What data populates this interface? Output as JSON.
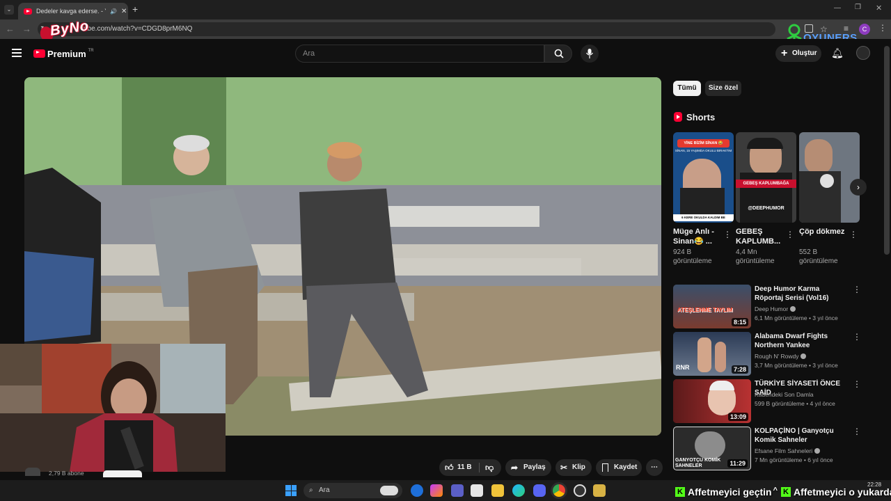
{
  "browser": {
    "tab_title": "Dedeler kavga ederse. - Yo",
    "url": "ube.com/watch?v=CDGD8prM6NQ",
    "new_tab": "+",
    "profile_initial": "C"
  },
  "yt": {
    "premium_label": "Premium",
    "premium_badge": "TR",
    "search_placeholder": "Ara",
    "create_label": "Oluştur"
  },
  "chips": [
    "Tümü",
    "Size özel"
  ],
  "shorts": {
    "title": "Shorts",
    "items": [
      {
        "title": "Müge Anlı - Sinan😂 ...",
        "views": "924 B görüntüleme",
        "overlay_top": "YİNE BİZİM SİNAN 😂",
        "overlay_sub": "SİNAN, 15 YAŞIMDA OKULU BIRAKTIM",
        "overlay_bottom": "6 KERE OKULDA KALDIM BE"
      },
      {
        "title": "GEBEŞ KAPLUMB...",
        "views": "4,4 Mn görüntüleme",
        "overlay_top": "GEBEŞ KAPLUMBAĞA",
        "overlay_bottom": "@DEEPHUMOR"
      },
      {
        "title": "Çöp dökmez",
        "views": "552 B görüntüleme"
      }
    ]
  },
  "related": [
    {
      "title": "Deep Humor Karma Röportaj Serisi (Vol16)",
      "channel": "Deep Humor",
      "meta": "6,1 Mn görüntüleme • 3 yıl önce",
      "duration": "8:15",
      "thumb_text": "ATEŞLENME TAYLIM",
      "color": "#7a3b2f"
    },
    {
      "title": "Alabama Dwarf Fights Northern Yankee",
      "channel": "Rough N' Rowdy",
      "meta": "3,7 Mn görüntüleme • 3 yıl önce",
      "duration": "7:28",
      "thumb_text": "RNR",
      "color": "#3a4f66"
    },
    {
      "title": "TÜRKİYE SİYASETİ ÖNCE SAİD",
      "channel": "Kadehdeki Son Damla",
      "meta": "599 B görüntüleme • 4 yıl önce",
      "duration": "13:09",
      "thumb_text": "",
      "color": "#8a2a2a"
    },
    {
      "title": "KOLPAÇİNO | Ganyotçu Komik Sahneler",
      "channel": "Efsane Film Sahneleri",
      "meta": "7 Mn görüntüleme • 6 yıl önce",
      "duration": "11:29",
      "thumb_text": "GANYOTÇU KOMİK SAHNELER",
      "color": "#2b2b2b"
    }
  ],
  "actions": {
    "likes": "11 B",
    "share": "Paylaş",
    "clip": "Klip",
    "save": "Kaydet"
  },
  "channel_subs": "2,79 B abone",
  "taskbar": {
    "search_label": "Ara",
    "time": "22:28"
  },
  "logos": {
    "byno": "ByNo",
    "oyuners": "OYUNERS"
  },
  "overlay": {
    "chat1": "Affetmeyici geçtin",
    "chat1_symbol": "^",
    "chat2": "Affetmeyici o yukarda"
  },
  "colors": {
    "yt_red": "#ff0033",
    "chat_green": "#53fc18"
  }
}
